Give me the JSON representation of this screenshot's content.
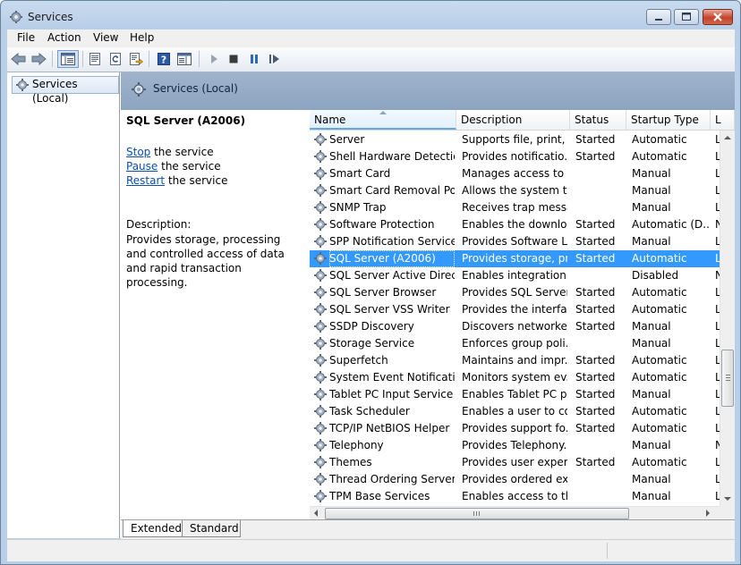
{
  "window": {
    "title": "Services"
  },
  "menu": [
    "File",
    "Action",
    "View",
    "Help"
  ],
  "tree": {
    "item": "Services (Local)"
  },
  "pane": {
    "title": "Services (Local)"
  },
  "detail": {
    "service_name": "SQL Server (A2006)",
    "actions": [
      {
        "link": "Stop",
        "rest": " the service"
      },
      {
        "link": "Pause",
        "rest": " the service"
      },
      {
        "link": "Restart",
        "rest": " the service"
      }
    ],
    "description_label": "Description:",
    "description": "Provides storage, processing and controlled access of data and rapid transaction processing."
  },
  "columns": {
    "name": "Name",
    "description": "Description",
    "status": "Status",
    "startup": "Startup Type",
    "logon": "L"
  },
  "services": [
    {
      "name": "Server",
      "description": "Supports file, print, ...",
      "status": "Started",
      "startup": "Automatic",
      "logon": "L"
    },
    {
      "name": "Shell Hardware Detection",
      "description": "Provides notificatio...",
      "status": "Started",
      "startup": "Automatic",
      "logon": "L"
    },
    {
      "name": "Smart Card",
      "description": "Manages access to ...",
      "status": "",
      "startup": "Manual",
      "logon": "L"
    },
    {
      "name": "Smart Card Removal Poli...",
      "description": "Allows the system t...",
      "status": "",
      "startup": "Manual",
      "logon": "L"
    },
    {
      "name": "SNMP Trap",
      "description": "Receives trap messa...",
      "status": "",
      "startup": "Manual",
      "logon": "L"
    },
    {
      "name": "Software Protection",
      "description": "Enables the downlo...",
      "status": "Started",
      "startup": "Automatic (D...",
      "logon": "N"
    },
    {
      "name": "SPP Notification Service",
      "description": "Provides Software Li...",
      "status": "Started",
      "startup": "Manual",
      "logon": "L"
    },
    {
      "name": "SQL Server (A2006)",
      "description": "Provides storage, pr...",
      "status": "Started",
      "startup": "Automatic",
      "logon": "L",
      "selected": true
    },
    {
      "name": "SQL Server Active Direct...",
      "description": "Enables integration ...",
      "status": "",
      "startup": "Disabled",
      "logon": "N"
    },
    {
      "name": "SQL Server Browser",
      "description": "Provides SQL Server...",
      "status": "Started",
      "startup": "Automatic",
      "logon": "L"
    },
    {
      "name": "SQL Server VSS Writer",
      "description": "Provides the interfa...",
      "status": "Started",
      "startup": "Automatic",
      "logon": "L"
    },
    {
      "name": "SSDP Discovery",
      "description": "Discovers networke...",
      "status": "Started",
      "startup": "Manual",
      "logon": "L"
    },
    {
      "name": "Storage Service",
      "description": "Enforces group poli...",
      "status": "",
      "startup": "Manual",
      "logon": "L"
    },
    {
      "name": "Superfetch",
      "description": "Maintains and impr...",
      "status": "Started",
      "startup": "Automatic",
      "logon": "L"
    },
    {
      "name": "System Event Notificatio...",
      "description": "Monitors system ev...",
      "status": "Started",
      "startup": "Automatic",
      "logon": "L"
    },
    {
      "name": "Tablet PC Input Service",
      "description": "Enables Tablet PC p...",
      "status": "Started",
      "startup": "Manual",
      "logon": "L"
    },
    {
      "name": "Task Scheduler",
      "description": "Enables a user to co...",
      "status": "Started",
      "startup": "Automatic",
      "logon": "L"
    },
    {
      "name": "TCP/IP NetBIOS Helper",
      "description": "Provides support fo...",
      "status": "Started",
      "startup": "Automatic",
      "logon": "L"
    },
    {
      "name": "Telephony",
      "description": "Provides Telephony...",
      "status": "",
      "startup": "Manual",
      "logon": "N"
    },
    {
      "name": "Themes",
      "description": "Provides user experi...",
      "status": "Started",
      "startup": "Automatic",
      "logon": "L"
    },
    {
      "name": "Thread Ordering Server",
      "description": "Provides ordered ex...",
      "status": "",
      "startup": "Manual",
      "logon": "L"
    },
    {
      "name": "TPM Base Services",
      "description": "Enables access to th...",
      "status": "",
      "startup": "Manual",
      "logon": "L"
    }
  ],
  "tabs": {
    "extended": "Extended",
    "standard": "Standard"
  },
  "colors": {
    "selection": "#3399ff",
    "link": "#0b4fa8",
    "header_band": "#9fb3cb"
  },
  "icons": {
    "service": "gear-icon"
  }
}
